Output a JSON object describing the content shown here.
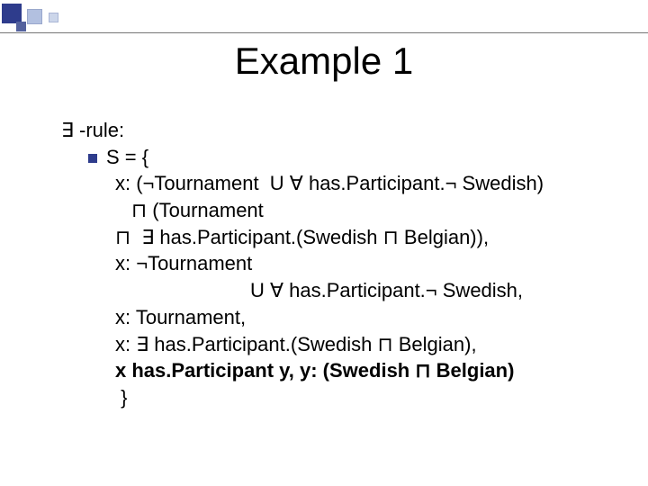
{
  "title": "Example 1",
  "rule_label": "∃ -rule:",
  "lines": {
    "l1": "S = {",
    "l2": "x: (¬Tournament  U ∀ has.Participant.¬ Swedish)",
    "l3": "⊓ (Tournament",
    "l4": "⊓  ∃ has.Participant.(Swedish ⊓ Belgian)),",
    "l5": "x: ¬Tournament",
    "l6": "U ∀ has.Participant.¬ Swedish,",
    "l7": "x: Tournament,",
    "l8": "x: ∃ has.Participant.(Swedish ⊓ Belgian),",
    "l9": "x has.Participant y, y: (Swedish ⊓ Belgian)",
    "l10": " }"
  }
}
